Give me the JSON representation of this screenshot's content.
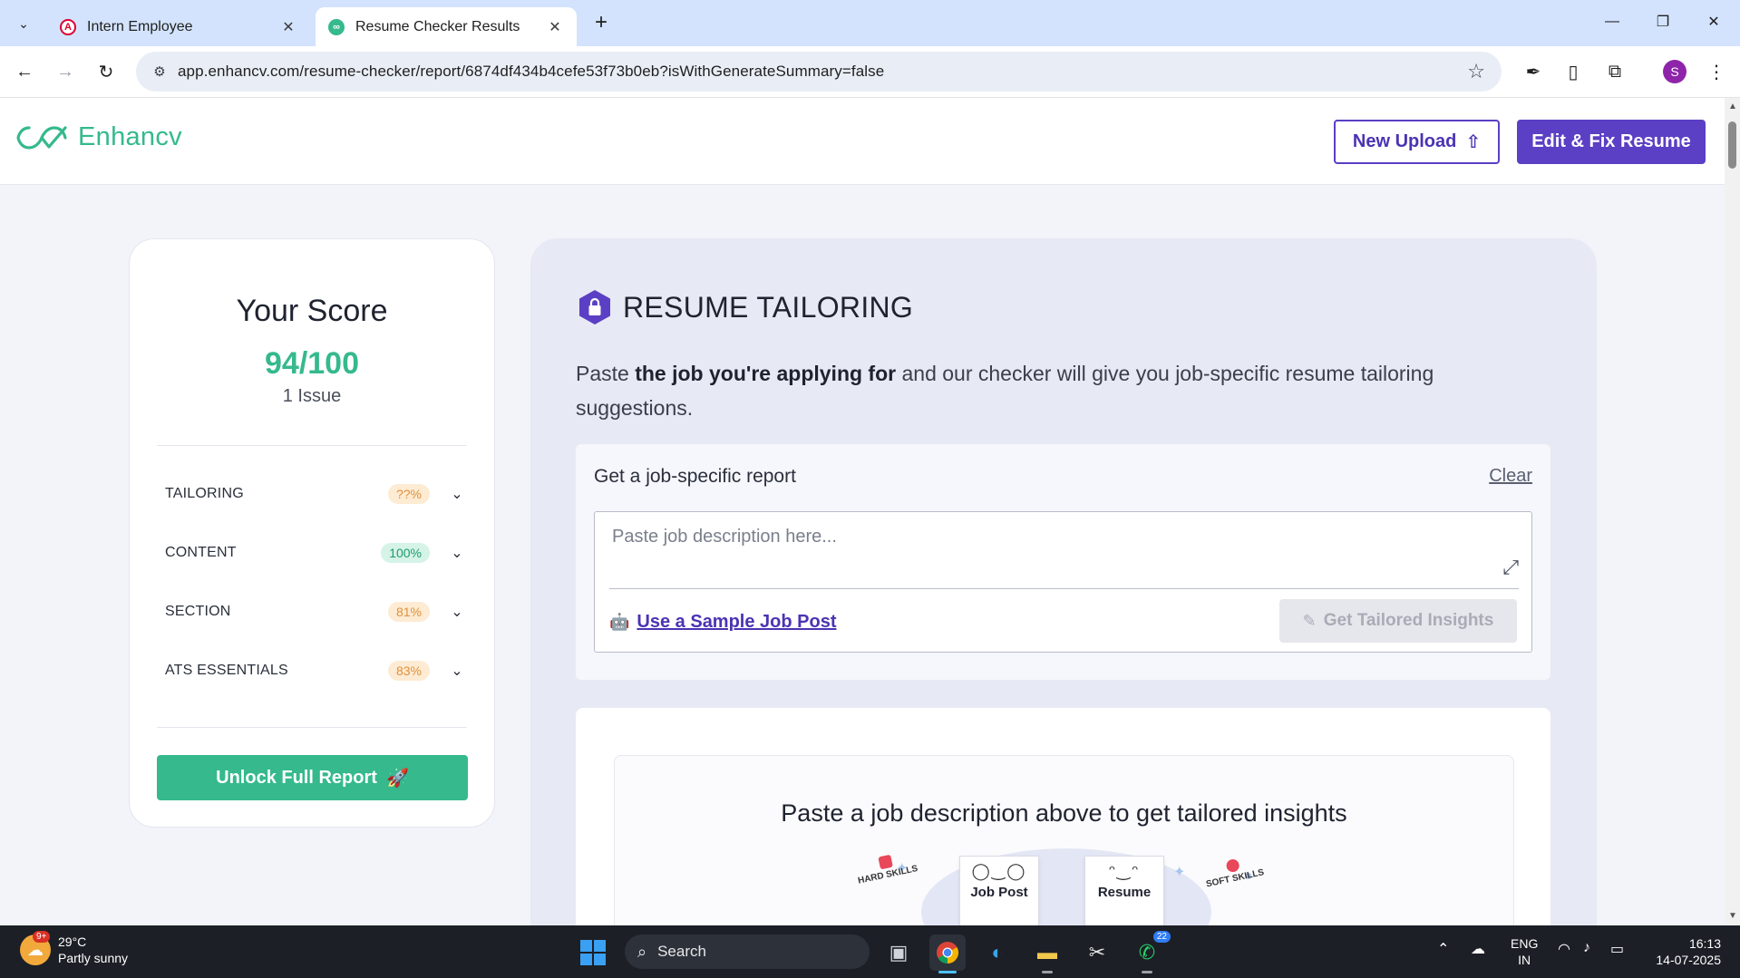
{
  "browser": {
    "tabs": [
      {
        "title": "Intern Employee",
        "favicon": "angular-icon",
        "active": false
      },
      {
        "title": "Resume Checker Results",
        "favicon": "enhancv-icon",
        "active": true
      }
    ],
    "url": "app.enhancv.com/resume-checker/report/6874df434b4cefe53f73b0eb?isWithGenerateSummary=false",
    "profile_initial": "S"
  },
  "header": {
    "logo_text": "Enhancv",
    "new_upload_label": "New Upload",
    "edit_fix_label": "Edit & Fix Resume"
  },
  "score": {
    "title": "Your Score",
    "value": "94/100",
    "issues": "1 Issue",
    "categories": [
      {
        "name": "TAILORING",
        "badge": "??%",
        "status": "warn"
      },
      {
        "name": "CONTENT",
        "badge": "100%",
        "status": "good"
      },
      {
        "name": "SECTION",
        "badge": "81%",
        "status": "warn"
      },
      {
        "name": "ATS ESSENTIALS",
        "badge": "83%",
        "status": "warn"
      }
    ],
    "unlock_label": "Unlock Full Report"
  },
  "tailoring": {
    "title": "RESUME TAILORING",
    "desc_prefix": "Paste ",
    "desc_bold": "the job you're applying for",
    "desc_suffix": " and our checker will give you job-specific resume tailoring suggestions.",
    "report_label": "Get a job-specific report",
    "clear_label": "Clear",
    "placeholder": "Paste job description here...",
    "sample_label": "Use a Sample Job Post",
    "insights_label": "Get Tailored Insights",
    "insights_title": "Paste a job description above to get tailored insights",
    "illustration": {
      "hard_skills": "HARD SKILLS",
      "soft_skills": "SOFT SKILLS",
      "job_post": "Job Post",
      "resume": "Resume"
    }
  },
  "taskbar": {
    "weather_temp": "29°C",
    "weather_desc": "Partly sunny",
    "weather_badge": "9+",
    "search_label": "Search",
    "whatsapp_badge": "22",
    "lang_line1": "ENG",
    "lang_line2": "IN",
    "time": "16:13",
    "date": "14-07-2025"
  },
  "colors": {
    "brand_green": "#35b98d",
    "brand_purple": "#5b3fc4",
    "warn_badge": "#fdebd3",
    "good_badge": "#d5f3e7"
  }
}
